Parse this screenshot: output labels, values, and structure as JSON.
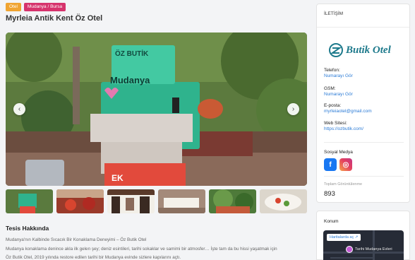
{
  "tags": [
    "Otel",
    "Mudanya / Bursa"
  ],
  "title": "Myrleia Antik Kent Öz Otel",
  "gallery": {
    "prev_icon": "‹",
    "next_icon": "›",
    "sign_top": "ÖZ BUTİK",
    "sign_main": "Mudanya",
    "basin_text": "EK",
    "thumbnail_count": 6
  },
  "about": {
    "heading": "Tesis Hakkında",
    "lines": [
      "Mudanya'nın Kalbinde Sıcacık Bir Konaklama Deneyimi – Öz Butik Otel",
      "Mudanya konaklama denince akla ilk gelen şey; deniz esintileri, tarihi sokaklar ve samimi bir atmosfer… İşte tam da bu hissi yaşatmak için",
      "Öz Butik Otel, 2019 yılında restore edilen tarihi bir Mudanya evinde sizlere kapılarını açtı."
    ]
  },
  "contact": {
    "heading": "İLETİŞİM",
    "logo_text": "Butik Otel",
    "phone_label": "Telefon:",
    "phone_value": "Numarayı Gör",
    "gsm_label": "GSM:",
    "gsm_value": "Numarayı Gör",
    "email_label": "E-posta:",
    "email_value": "myrleiaotel@gmail.com",
    "web_label": "Web Sitesi:",
    "web_value": "https://ozbutik.com/",
    "social_label": "Sosyal Medya",
    "facebook_glyph": "f",
    "instagram_glyph": "◎",
    "views_label": "Toplam Görüntülenme",
    "views_value": "893"
  },
  "location": {
    "heading": "Konum",
    "map_button": "Haritalarda aç ↗",
    "map_place": "Tarihi Mudanya Evleri"
  },
  "colors": {
    "accent_orange": "#f0a431",
    "accent_pink": "#d6336c",
    "link_blue": "#2b7bd6",
    "logo_teal": "#1e7a8c"
  }
}
